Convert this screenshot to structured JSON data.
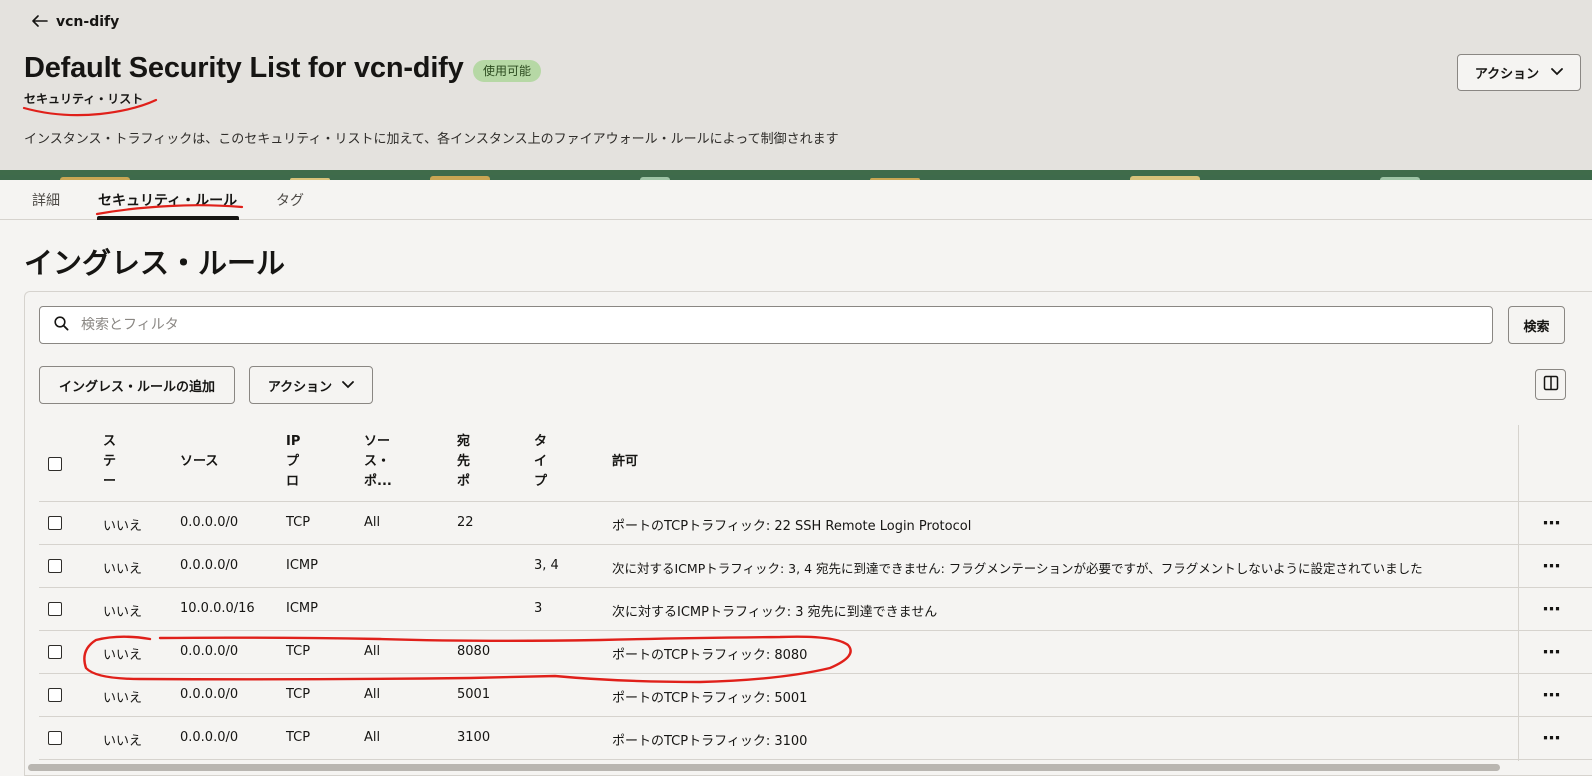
{
  "header": {
    "back_label": "vcn-dify",
    "title": "Default Security List for vcn-dify",
    "status": "使用可能",
    "subtitle": "セキュリティ・リスト",
    "description": "インスタンス・トラフィックは、このセキュリティ・リストに加えて、各インスタンス上のファイアウォール・ルールによって制御されます",
    "action_label": "アクション"
  },
  "tabs": [
    {
      "label": "詳細"
    },
    {
      "label": "セキュリティ・ルール"
    },
    {
      "label": "タグ"
    }
  ],
  "section": {
    "title": "イングレス・ルール"
  },
  "search": {
    "placeholder": "検索とフィルタ",
    "button": "検索"
  },
  "toolbar": {
    "add_label": "イングレス・ルールの追加",
    "action_label": "アクション"
  },
  "table": {
    "headers": {
      "state": [
        "ス",
        "テ",
        "ー"
      ],
      "source": "ソース",
      "ip_protocol": [
        "IP",
        "プ",
        "ロ"
      ],
      "source_port": [
        "ソー",
        "ス・",
        "ポ..."
      ],
      "dest_port": [
        "宛",
        "先",
        "ポ"
      ],
      "type": [
        "タ",
        "イ",
        "プ"
      ],
      "allow": "許可"
    },
    "rows": [
      {
        "state": "いいえ",
        "source": "0.0.0.0/0",
        "protocol": "TCP",
        "source_port": "All",
        "dest_port": "22",
        "type": "",
        "allow": "ポートのTCPトラフィック: 22 SSH Remote Login Protocol"
      },
      {
        "state": "いいえ",
        "source": "0.0.0.0/0",
        "protocol": "ICMP",
        "source_port": "",
        "dest_port": "",
        "type": "3, 4",
        "allow": "次に対するICMPトラフィック: 3, 4 宛先に到達できません: フラグメンテーションが必要ですが、フラグメントしないように設定されていました"
      },
      {
        "state": "いいえ",
        "source": "10.0.0.0/16",
        "protocol": "ICMP",
        "source_port": "",
        "dest_port": "",
        "type": "3",
        "allow": "次に対するICMPトラフィック: 3 宛先に到達できません"
      },
      {
        "state": "いいえ",
        "source": "0.0.0.0/0",
        "protocol": "TCP",
        "source_port": "All",
        "dest_port": "8080",
        "type": "",
        "allow": "ポートのTCPトラフィック: 8080"
      },
      {
        "state": "いいえ",
        "source": "0.0.0.0/0",
        "protocol": "TCP",
        "source_port": "All",
        "dest_port": "5001",
        "type": "",
        "allow": "ポートのTCPトラフィック: 5001"
      },
      {
        "state": "いいえ",
        "source": "0.0.0.0/0",
        "protocol": "TCP",
        "source_port": "All",
        "dest_port": "3100",
        "type": "",
        "allow": "ポートのTCPトラフィック: 3100"
      }
    ],
    "row_menu": "⋯"
  },
  "icons": {
    "back": "arrow-left-icon",
    "search": "search-icon",
    "chevron": "chevron-down-icon",
    "columns": "columns-icon",
    "row_menu": "more-horizontal-icon"
  },
  "colors": {
    "status_badge_bg": "#b6d8a5",
    "annotation_red": "#e0201a",
    "header_bg": "#e4e2de"
  }
}
